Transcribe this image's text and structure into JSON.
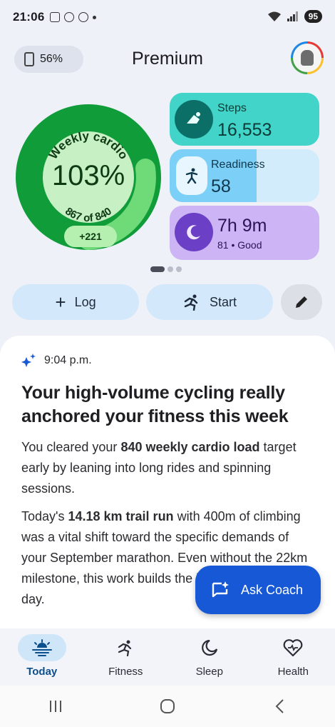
{
  "status": {
    "time": "21:06",
    "battery": "95"
  },
  "header": {
    "device_battery": "56%",
    "title": "Premium"
  },
  "weekly_cardio": {
    "label": "Weekly cardio",
    "percent": "103%",
    "progress_text": "867 of 840",
    "delta": "+221",
    "progress_fraction": 1.03
  },
  "cards": {
    "steps": {
      "label": "Steps",
      "value": "16,553"
    },
    "readiness": {
      "label": "Readiness",
      "value": "58",
      "level": 0.58
    },
    "sleep": {
      "value": "7h 9m",
      "sub": "81 • Good"
    }
  },
  "actions": {
    "log": "Log",
    "start": "Start"
  },
  "insight": {
    "time": "9:04 p.m.",
    "title": "Your high-volume cycling really anchored your fitness this week",
    "p1_a": "You cleared your ",
    "p1_b": "840 weekly cardio load",
    "p1_c": " target early by leaning into long rides and spinning sessions.",
    "p2_a": "Today's ",
    "p2_b": "14.18 km trail run",
    "p2_c": " with 400m of climbing was a vital shift toward the specific demands of your September marathon. Even without the 22km milestone, this work builds the leg strength for race day."
  },
  "fab": {
    "label": "Ask Coach"
  },
  "nav": [
    {
      "label": "Today"
    },
    {
      "label": "Fitness"
    },
    {
      "label": "Sleep"
    },
    {
      "label": "Health"
    }
  ],
  "colors": {
    "ring_dark": "#119c3a",
    "ring_light": "#5fd06a",
    "fab": "#1658d6",
    "steps": "#42d4c8",
    "sleep": "#cdb4f4"
  }
}
